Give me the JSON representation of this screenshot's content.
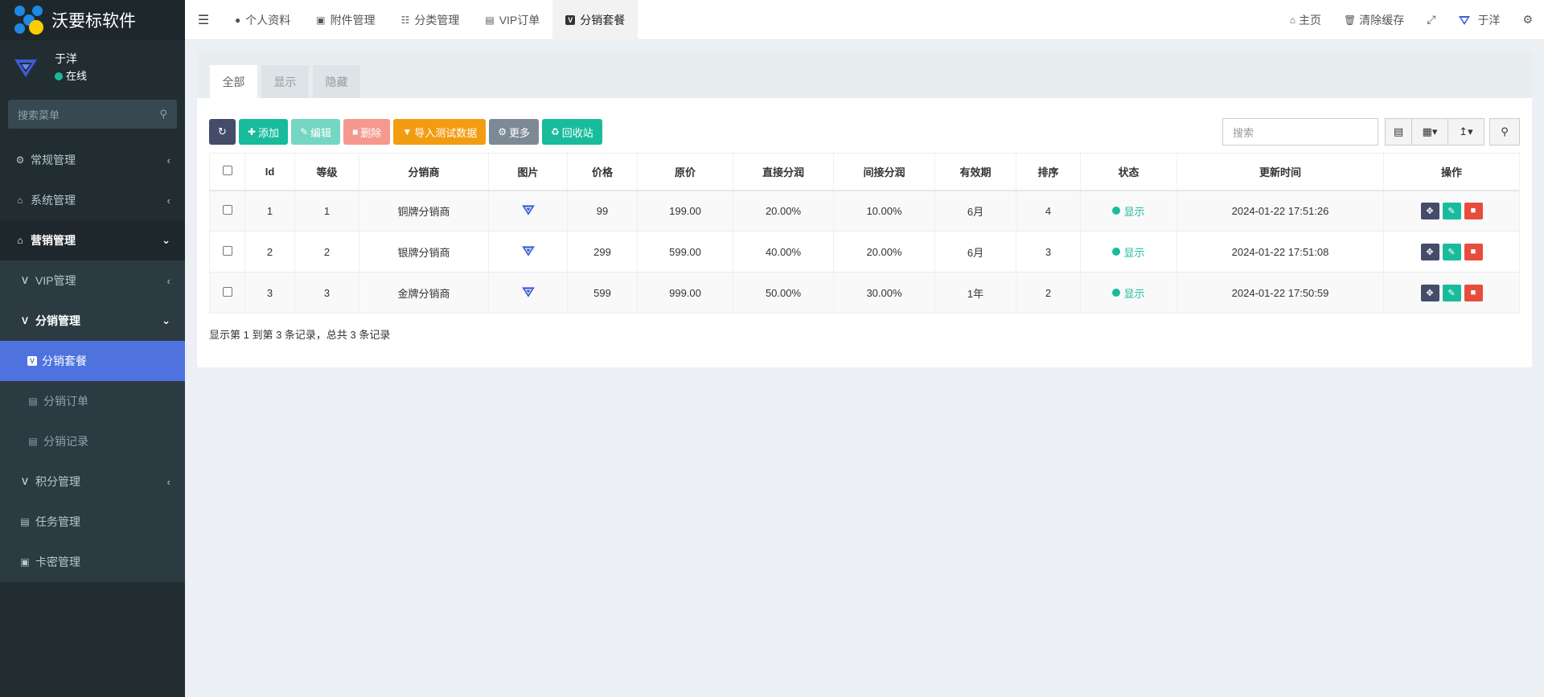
{
  "app": {
    "title": "沃要标软件"
  },
  "user": {
    "name": "于洋",
    "status": "在线"
  },
  "sidebar": {
    "search_placeholder": "搜索菜单",
    "items": [
      {
        "label": "常规管理",
        "icon": "cogs-icon"
      },
      {
        "label": "系统管理",
        "icon": "home-icon"
      },
      {
        "label": "营销管理",
        "icon": "home-icon"
      },
      {
        "label": "VIP管理",
        "icon": "v-icon"
      },
      {
        "label": "分销管理",
        "icon": "v-icon"
      },
      {
        "label": "分销套餐",
        "icon": "v-square-icon"
      },
      {
        "label": "分销订单",
        "icon": "file-icon"
      },
      {
        "label": "分销记录",
        "icon": "file-icon"
      },
      {
        "label": "积分管理",
        "icon": "v-icon"
      },
      {
        "label": "任务管理",
        "icon": "file-icon"
      },
      {
        "label": "卡密管理",
        "icon": "money-icon"
      }
    ]
  },
  "topnav": {
    "tabs": [
      {
        "label": "个人资料"
      },
      {
        "label": "附件管理"
      },
      {
        "label": "分类管理"
      },
      {
        "label": "VIP订单"
      },
      {
        "label": "分销套餐"
      }
    ],
    "right": {
      "home": "主页",
      "clear_cache": "清除缓存",
      "user": "于洋"
    }
  },
  "panel": {
    "tabs": [
      "全部",
      "显示",
      "隐藏"
    ]
  },
  "toolbar": {
    "add": "添加",
    "edit": "编辑",
    "delete": "删除",
    "import": "导入测试数据",
    "more": "更多",
    "recycle": "回收站",
    "search_placeholder": "搜索"
  },
  "table": {
    "headers": [
      "Id",
      "等级",
      "分销商",
      "图片",
      "价格",
      "原价",
      "直接分润",
      "间接分润",
      "有效期",
      "排序",
      "状态",
      "更新时间",
      "操作"
    ],
    "rows": [
      {
        "id": "1",
        "level": "1",
        "name": "铜牌分销商",
        "price": "99",
        "original": "199.00",
        "direct": "20.00%",
        "indirect": "10.00%",
        "validity": "6月",
        "sort": "4",
        "status": "显示",
        "updated": "2024-01-22 17:51:26"
      },
      {
        "id": "2",
        "level": "2",
        "name": "银牌分销商",
        "price": "299",
        "original": "599.00",
        "direct": "40.00%",
        "indirect": "20.00%",
        "validity": "6月",
        "sort": "3",
        "status": "显示",
        "updated": "2024-01-22 17:51:08"
      },
      {
        "id": "3",
        "level": "3",
        "name": "金牌分销商",
        "price": "599",
        "original": "999.00",
        "direct": "50.00%",
        "indirect": "30.00%",
        "validity": "1年",
        "sort": "2",
        "status": "显示",
        "updated": "2024-01-22 17:50:59"
      }
    ]
  },
  "summary": "显示第 1 到第 3 条记录，总共 3 条记录",
  "colors": {
    "accent": "#4e73df",
    "green": "#18bc9c",
    "sidebar": "#222d32"
  }
}
